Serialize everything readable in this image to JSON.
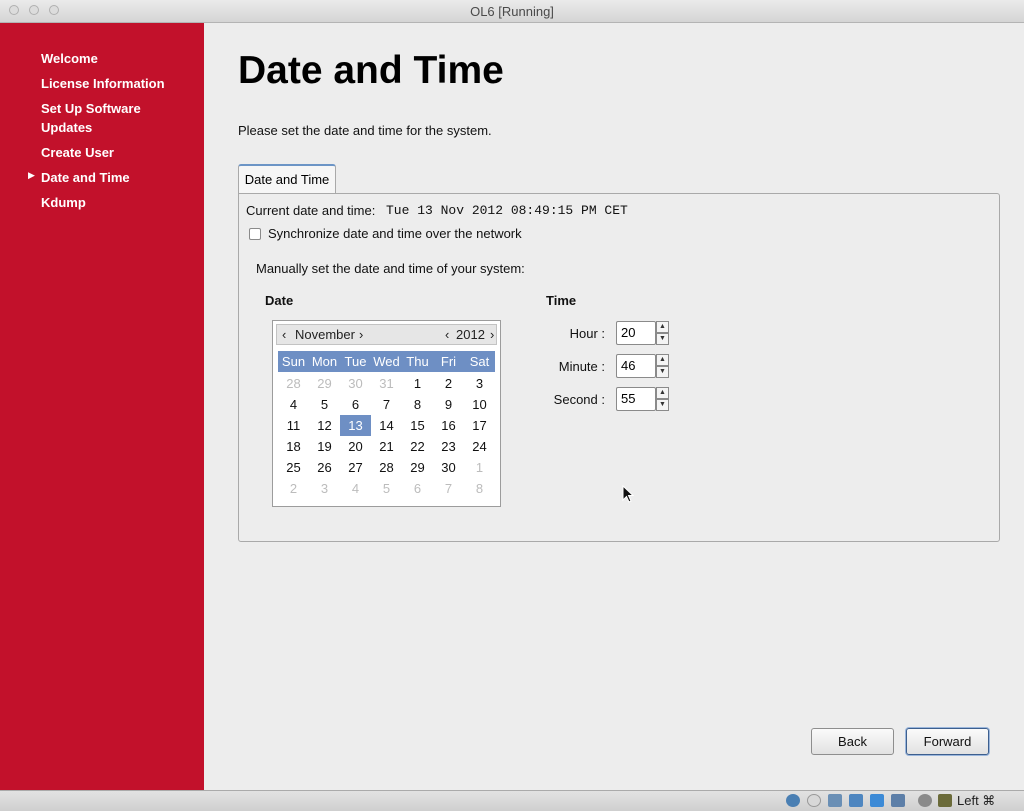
{
  "window": {
    "title": "OL6 [Running]"
  },
  "sidebar": {
    "items": [
      {
        "label": "Welcome"
      },
      {
        "label": "License Information"
      },
      {
        "label": "Set Up Software Updates"
      },
      {
        "label": "Create User"
      },
      {
        "label": "Date and Time",
        "active": true
      },
      {
        "label": "Kdump"
      }
    ]
  },
  "page": {
    "title": "Date and Time",
    "subtitle": "Please set the date and time for the system."
  },
  "tab": {
    "label": "Date and Time"
  },
  "panel": {
    "current_label": "Current date and time:",
    "current_value": "Tue 13 Nov 2012 08:49:15 PM CET",
    "sync_label": "Synchronize date and time over the network",
    "sync_checked": false,
    "manual_label": "Manually set the date and time of your system:",
    "date_heading": "Date",
    "time_heading": "Time"
  },
  "calendar": {
    "month": "November",
    "year": "2012",
    "day_names": [
      "Sun",
      "Mon",
      "Tue",
      "Wed",
      "Thu",
      "Fri",
      "Sat"
    ],
    "weeks": [
      [
        "28",
        "29",
        "30",
        "31",
        "1",
        "2",
        "3"
      ],
      [
        "4",
        "5",
        "6",
        "7",
        "8",
        "9",
        "10"
      ],
      [
        "11",
        "12",
        "13",
        "14",
        "15",
        "16",
        "17"
      ],
      [
        "18",
        "19",
        "20",
        "21",
        "22",
        "23",
        "24"
      ],
      [
        "25",
        "26",
        "27",
        "28",
        "29",
        "30",
        "1"
      ],
      [
        "2",
        "3",
        "4",
        "5",
        "6",
        "7",
        "8"
      ]
    ],
    "selected_day": "13"
  },
  "time": {
    "hour_label": "Hour :",
    "hour_value": "20",
    "minute_label": "Minute :",
    "minute_value": "46",
    "second_label": "Second :",
    "second_value": "55"
  },
  "buttons": {
    "back": "Back",
    "forward": "Forward"
  },
  "statusbar": {
    "host_key": "Left ⌘"
  },
  "colors": {
    "sidebar": "#c2112b",
    "accent": "#6e8fc4"
  }
}
